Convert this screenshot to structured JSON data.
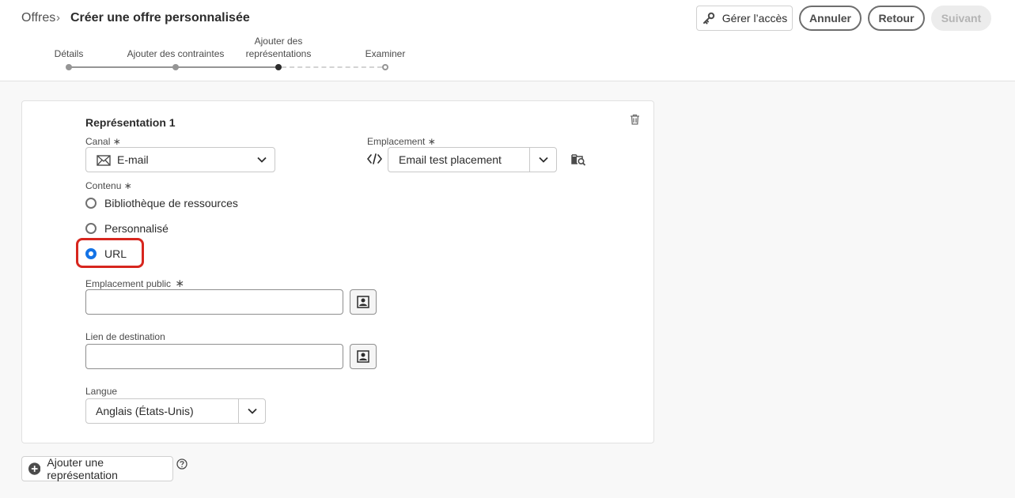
{
  "header": {
    "breadcrumb_root": "Offres",
    "breadcrumb_sep": "›",
    "title": "Créer une offre personnalisée",
    "buttons": {
      "access": "Gérer l’accès",
      "cancel": "Annuler",
      "back": "Retour",
      "next": "Suivant"
    }
  },
  "stepper": {
    "steps": [
      {
        "label": "Détails",
        "state": "done"
      },
      {
        "label": "Ajouter des contraintes",
        "state": "done"
      },
      {
        "label": "Ajouter des représentations",
        "state": "current"
      },
      {
        "label": "Examiner",
        "state": "future"
      }
    ]
  },
  "representation": {
    "title": "Représentation 1",
    "channel": {
      "label": "Canal ∗",
      "value": "E-mail",
      "icon": "envelope-icon"
    },
    "placement": {
      "label": "Emplacement ∗",
      "value": "Email test placement",
      "icon": "code-icon"
    },
    "content": {
      "label": "Contenu ∗",
      "options": [
        "Bibliothèque de ressources",
        "Personnalisé",
        "URL"
      ],
      "selected": "URL"
    },
    "public_location": {
      "label": "Emplacement public",
      "required": "∗",
      "value": ""
    },
    "destination_link": {
      "label": "Lien de destination",
      "value": ""
    },
    "language": {
      "label": "Langue",
      "value": "Anglais (États-Unis)"
    }
  },
  "footer": {
    "add_label": "Ajouter une représentation"
  },
  "colors": {
    "accent": "#1473e6",
    "highlight": "#d7261e"
  }
}
